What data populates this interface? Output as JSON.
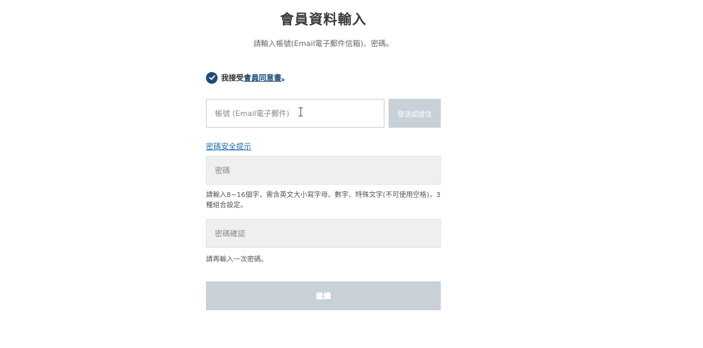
{
  "header": {
    "title": "會員資料輸入",
    "subtitle": "請輸入帳號(Email電子郵件信箱)、密碼。"
  },
  "agreement": {
    "prefix": "我接受",
    "link_text": "會員同意書",
    "suffix": "。",
    "checked": true,
    "check_color": "#1f4b7a"
  },
  "account": {
    "placeholder": "帳號 (Email電子郵件)",
    "send_button_label": "發送認證信"
  },
  "password_tip_link": "密碼安全提示",
  "password": {
    "placeholder": "密碼",
    "hint": "請輸入8~16個字，需含英文大小寫字母、數字、特殊文字(不可使用空格)，3種組合設定。"
  },
  "password_confirm": {
    "placeholder": "密碼確認",
    "hint": "請再輸入一次密碼。"
  },
  "continue_button_label": "繼續",
  "colors": {
    "accent": "#1f4b7a",
    "link": "#1f6fb0",
    "disabled_button": "#c8d0d8"
  }
}
